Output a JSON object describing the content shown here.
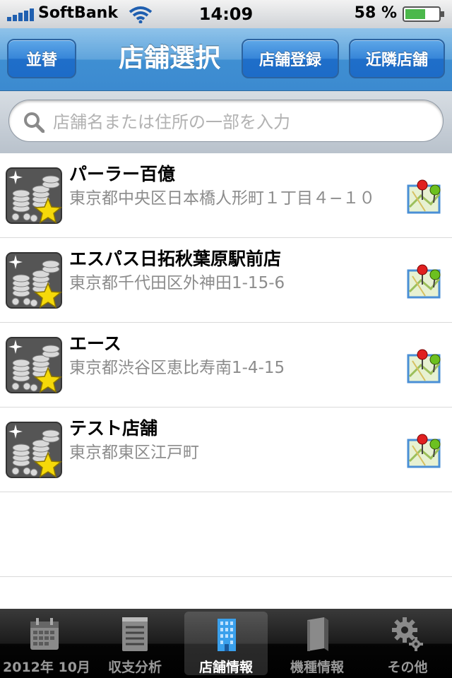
{
  "status_bar": {
    "carrier": "SoftBank",
    "time": "14:09",
    "battery": "58 %"
  },
  "nav": {
    "sort_label": "並替",
    "title": "店舗選択",
    "register_label": "店舗登録",
    "nearby_label": "近隣店舗"
  },
  "search": {
    "placeholder": "店舗名または住所の一部を入力",
    "value": ""
  },
  "stores": [
    {
      "name": "パーラー百億",
      "address": "東京都中央区日本橋人形町１丁目４−１０"
    },
    {
      "name": "エスパス日拓秋葉原駅前店",
      "address": "東京都千代田区外神田1-15-6"
    },
    {
      "name": "エース",
      "address": "東京都渋谷区恵比寿南1-4-15"
    },
    {
      "name": "テスト店舗",
      "address": "東京都東区江戸町"
    }
  ],
  "tabs": [
    {
      "label": "2012年 10月",
      "icon": "calendar-icon"
    },
    {
      "label": "収支分析",
      "icon": "notepad-icon"
    },
    {
      "label": "店舗情報",
      "icon": "building-icon",
      "active": true
    },
    {
      "label": "機種情報",
      "icon": "book-icon"
    },
    {
      "label": "その他",
      "icon": "gear-icon"
    }
  ],
  "colors": {
    "nav_blue": "#3c8ad0",
    "address_gray": "#8c8c8c",
    "tab_active": "#ffffff"
  }
}
